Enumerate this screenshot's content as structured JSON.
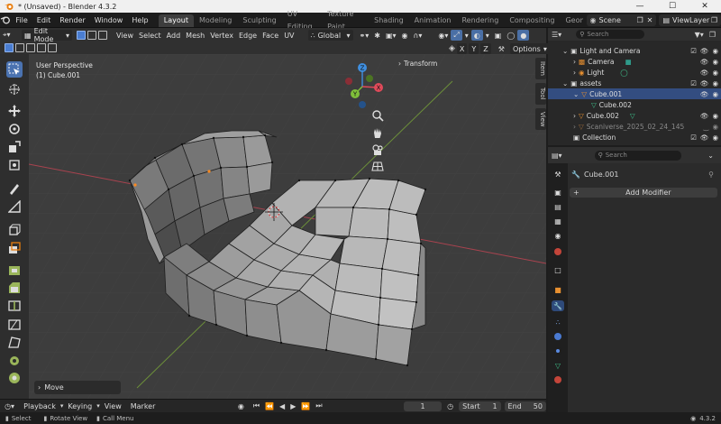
{
  "window": {
    "title": "* (Unsaved) - Blender 4.3.2",
    "minimize": "—",
    "maximize": "☐",
    "close": "✕"
  },
  "menu": [
    "File",
    "Edit",
    "Render",
    "Window",
    "Help"
  ],
  "workspaces": [
    "Layout",
    "Modeling",
    "Sculpting",
    "UV Editing",
    "Texture Paint",
    "Shading",
    "Animation",
    "Rendering",
    "Compositing",
    "Geome"
  ],
  "active_workspace": "Layout",
  "scene": {
    "name": "Scene",
    "view_layer": "ViewLayer"
  },
  "header": {
    "mode": "Edit Mode",
    "menus": [
      "View",
      "Select",
      "Add",
      "Mesh",
      "Vertex",
      "Edge",
      "Face",
      "UV"
    ],
    "transform_orientation": "Global",
    "options": "Options"
  },
  "viewport": {
    "view_name": "User Perspective",
    "object_name": "(1) Cube.001",
    "transform_panel": "Transform",
    "gizmo_labels": {
      "x": "X",
      "y": "Y",
      "z": "Z"
    },
    "xyz_toggles": [
      "X",
      "Y",
      "Z"
    ]
  },
  "sidebar_tabs": [
    "Item",
    "Tool",
    "View"
  ],
  "last_operator": "Move",
  "timeline": {
    "menus": [
      "Playback",
      "Keying",
      "View",
      "Marker"
    ],
    "current_frame": "1",
    "start_label": "Start",
    "start": "1",
    "end_label": "End",
    "end": "50"
  },
  "status": {
    "select": "Select",
    "rotate": "Rotate View",
    "call_menu": "Call Menu",
    "version": "4.3.2"
  },
  "outliner": {
    "search_placeholder": "Search",
    "rows": [
      {
        "label": "Light and Camera",
        "level": 0
      },
      {
        "label": "Camera",
        "level": 1
      },
      {
        "label": "Light",
        "level": 1
      },
      {
        "label": "assets",
        "level": 0
      },
      {
        "label": "Cube.001",
        "level": 1
      },
      {
        "label": "Cube.002",
        "level": 2
      },
      {
        "label": "Cube.002",
        "level": 1
      },
      {
        "label": "Scaniverse_2025_02_24_145",
        "level": 1
      },
      {
        "label": "Collection",
        "level": 0
      }
    ]
  },
  "properties": {
    "search_placeholder": "Search",
    "object_name": "Cube.001",
    "add_modifier": "Add Modifier"
  },
  "colors": {
    "accent": "#4a72b0",
    "mesh_face": "#8e8e8e",
    "viewport_bg": "#3d3d3d",
    "x_axis": "#e04a5a",
    "y_axis": "#7fbf3a",
    "z_axis": "#3f8fe0"
  }
}
